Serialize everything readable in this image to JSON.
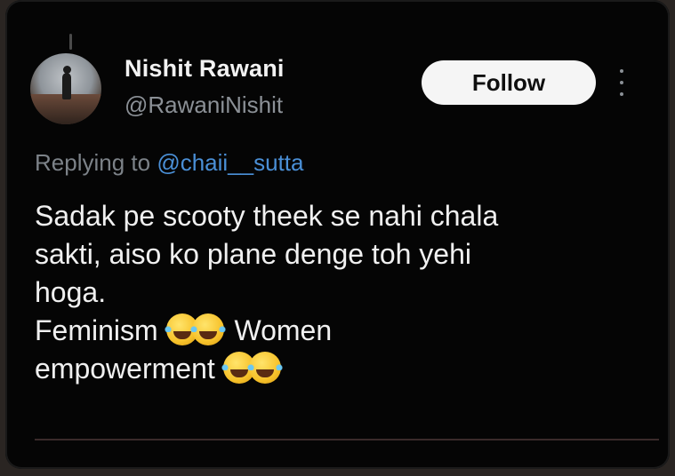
{
  "post": {
    "author_name": "Nishit Rawani",
    "author_handle": "@RawaniNishit",
    "follow_label": "Follow",
    "replying_prefix": "Replying to",
    "replying_to": "@chaii__sutta",
    "body_lines": [
      "Sadak pe scooty theek se nahi chala",
      "sakti, aiso ko plane denge toh yehi",
      "hoga."
    ],
    "line4_text_start": "Feminism",
    "line4_text_end": "Women",
    "line5_text": "empowerment",
    "emoji": "face-with-tears-of-joy"
  },
  "colors": {
    "background": "#050505",
    "follow_button": "#f5f5f5",
    "mention": "#4a8fd6",
    "secondary_text": "#8b9096"
  }
}
